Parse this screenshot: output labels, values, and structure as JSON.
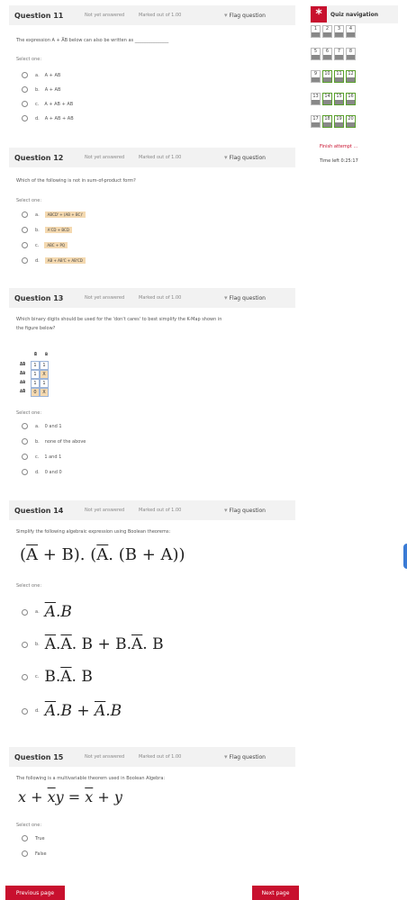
{
  "questions": [
    {
      "title": "Question 11",
      "status": "Not yet answered",
      "marked": "Marked out of 1.00",
      "flag": "Flag question",
      "text": "The expression  A + A̅B  below can also be written as _______________",
      "select": "Select one:",
      "options": [
        {
          "letter": "a.",
          "value": "A + AB"
        },
        {
          "letter": "b.",
          "value": "A + AB"
        },
        {
          "letter": "c.",
          "value": "A + AB + AB"
        },
        {
          "letter": "d.",
          "value": "A + AB + AB"
        }
      ]
    },
    {
      "title": "Question 12",
      "status": "Not yet answered",
      "marked": "Marked out of 1.00",
      "flag": "Flag question",
      "text": "Which of the following is not in sum-of-product form?",
      "select": "Select one:",
      "options": [
        {
          "letter": "a.",
          "value": "ABCD' + (AB + BC)'"
        },
        {
          "letter": "b.",
          "value": "A'CD + BCD"
        },
        {
          "letter": "c.",
          "value": "ABC + PQ"
        },
        {
          "letter": "d.",
          "value": "AB + AB'C + AB'CD"
        }
      ]
    },
    {
      "title": "Question 13",
      "status": "Not yet answered",
      "marked": "Marked out of 1.00",
      "flag": "Flag question",
      "text1": "Which binary digits should be used for the 'don't cares' to best simplify the K-Map shown in",
      "text2": "the figure below?",
      "select": "Select one:",
      "options": [
        {
          "letter": "a.",
          "value": "0 and 1"
        },
        {
          "letter": "b.",
          "value": "none of the above"
        },
        {
          "letter": "c.",
          "value": "1 and 1"
        },
        {
          "letter": "d.",
          "value": "0 and 0"
        }
      ]
    },
    {
      "title": "Question 14",
      "status": "Not yet answered",
      "marked": "Marked out of 1.00",
      "flag": "Flag question",
      "text": "Simplify the following algebraic expression using Boolean theorems:",
      "select": "Select one:",
      "options": [
        {
          "letter": "a."
        },
        {
          "letter": "b."
        },
        {
          "letter": "c."
        },
        {
          "letter": "d."
        }
      ]
    },
    {
      "title": "Question 15",
      "status": "Not yet answered",
      "marked": "Marked out of 1.00",
      "flag": "Flag question",
      "text": "The following is a multivariable theorem used in Boolean Algebra:",
      "select": "Select one:",
      "options": [
        {
          "value": "True"
        },
        {
          "value": "False"
        }
      ]
    }
  ],
  "kmap": {
    "cols": [
      "B̅",
      "B"
    ],
    "rows": [
      "A̅B̅",
      "A̅B",
      "AB",
      "AB̅"
    ],
    "cells": [
      [
        "1",
        "1"
      ],
      [
        "1",
        "X"
      ],
      [
        "1",
        "1"
      ],
      [
        "0",
        "X"
      ]
    ]
  },
  "nav": {
    "title": "Quiz navigation",
    "numbers": [
      "1",
      "2",
      "3",
      "4",
      "5",
      "6",
      "7",
      "8",
      "9",
      "10",
      "11",
      "12",
      "13",
      "14",
      "15",
      "16",
      "17",
      "18",
      "19",
      "20"
    ],
    "finish": "Finish attempt ...",
    "time": "Time left 0:25:17"
  },
  "buttons": {
    "prev": "Previous page",
    "next": "Next page"
  },
  "colors": {
    "accent": "#c8102e",
    "highlight": "#f4d9b0",
    "answered": "#5aa02c"
  }
}
